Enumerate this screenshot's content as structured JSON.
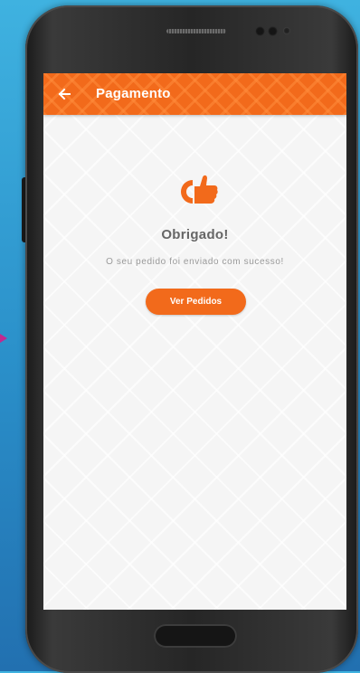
{
  "app_bar": {
    "title": "Pagamento",
    "back_icon": "arrow-left-icon",
    "color": "#f26a1b"
  },
  "success": {
    "icon": "thumbs-up-icon",
    "icon_color": "#f26a1b",
    "heading": "Obrigado!",
    "message": "O seu pedido foi enviado com sucesso!"
  },
  "actions": {
    "view_orders_label": "Ver Pedidos"
  }
}
